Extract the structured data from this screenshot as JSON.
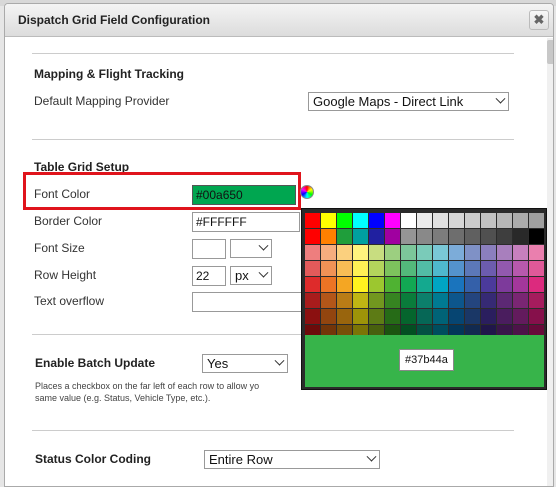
{
  "dialog": {
    "title": "Dispatch Grid Field Configuration",
    "close_glyph": "✖"
  },
  "mapping": {
    "heading": "Mapping & Flight Tracking",
    "provider_label": "Default Mapping Provider",
    "provider_value": "Google Maps - Direct Link"
  },
  "grid": {
    "heading": "Table Grid Setup",
    "font_color_label": "Font Color",
    "font_color_value": "#00a650",
    "border_color_label": "Border Color",
    "border_color_value": "#FFFFFF",
    "font_size_label": "Font Size",
    "font_size_value": "",
    "font_size_unit": "",
    "row_height_label": "Row Height",
    "row_height_value": "22",
    "row_height_unit": "px",
    "text_overflow_label": "Text overflow",
    "text_overflow_value": ""
  },
  "batch": {
    "label": "Enable Batch Update",
    "value": "Yes",
    "note_line1": "Places a checkbox on the far left of each row to allow yo",
    "note_line2": "same value (e.g. Status, Vehicle Type, etc.)."
  },
  "status": {
    "label": "Status Color Coding",
    "value": "Entire Row"
  },
  "colors": {
    "highlight_border": "#e0141c",
    "font_color_fill": "#00a650",
    "selected_color": "#37b44a"
  },
  "palette": {
    "hover_value": "#37b44a",
    "swatch_rows": [
      [
        "#ff0000",
        "#ffff00",
        "#00ff00",
        "#00ffff",
        "#0000ff",
        "#ff00ff",
        "#ffffff",
        "#ebebeb",
        "#e1e1e1",
        "#d7d7d7",
        "#cccccc",
        "#c2c2c2",
        "#b7b7b7",
        "#acacac",
        "#a0a0a0"
      ],
      [
        "#ff0000",
        "#ff8000",
        "#1f9e3b",
        "#00a0a0",
        "#2020a0",
        "#a000a0",
        "#959595",
        "#898989",
        "#7c7c7c",
        "#6e6e6e",
        "#606060",
        "#505050",
        "#3e3e3e",
        "#292929",
        "#000000"
      ],
      [
        "#ee7e7e",
        "#f6ad7e",
        "#fbd07e",
        "#fff37e",
        "#c8dd80",
        "#9ccf80",
        "#7cc79a",
        "#7acbb9",
        "#7ac8d7",
        "#7cacd9",
        "#7f91c6",
        "#8b7fbe",
        "#a87fbd",
        "#c780be",
        "#ea7fae"
      ],
      [
        "#e35a5a",
        "#f09256",
        "#f8bd55",
        "#fff055",
        "#b4d45c",
        "#7dc25d",
        "#53b97b",
        "#52bca6",
        "#4fb8cd",
        "#5493cd",
        "#5c78b8",
        "#6c5cae",
        "#9259ae",
        "#b759ad",
        "#e05998"
      ],
      [
        "#de2b2b",
        "#ec7425",
        "#f4a623",
        "#fff21f",
        "#9cc72f",
        "#4fb232",
        "#12a853",
        "#14a98f",
        "#00a5c3",
        "#1a74bd",
        "#3460a9",
        "#4b3a9b",
        "#7d3a9b",
        "#a3379b",
        "#dc2a7e"
      ],
      [
        "#a81c1c",
        "#b35619",
        "#b97c16",
        "#c0b514",
        "#72971f",
        "#368421",
        "#0a7c3b",
        "#0c7f6b",
        "#007a92",
        "#0d568c",
        "#24457e",
        "#362a74",
        "#5c2974",
        "#7a2673",
        "#a51c5d"
      ],
      [
        "#8b1010",
        "#92450f",
        "#99650d",
        "#9d9409",
        "#5d7b15",
        "#266b17",
        "#05652d",
        "#066756",
        "#006377",
        "#064572",
        "#1a3766",
        "#2a1e5e",
        "#4a1d5e",
        "#631b5d",
        "#86104b"
      ],
      [
        "#6c0b0b",
        "#733509",
        "#784f08",
        "#7b7406",
        "#48600e",
        "#1c5410",
        "#034f22",
        "#045043",
        "#004d5e",
        "#033659",
        "#122a50",
        "#20164a",
        "#39154a",
        "#4d1349",
        "#680a3a"
      ]
    ]
  }
}
